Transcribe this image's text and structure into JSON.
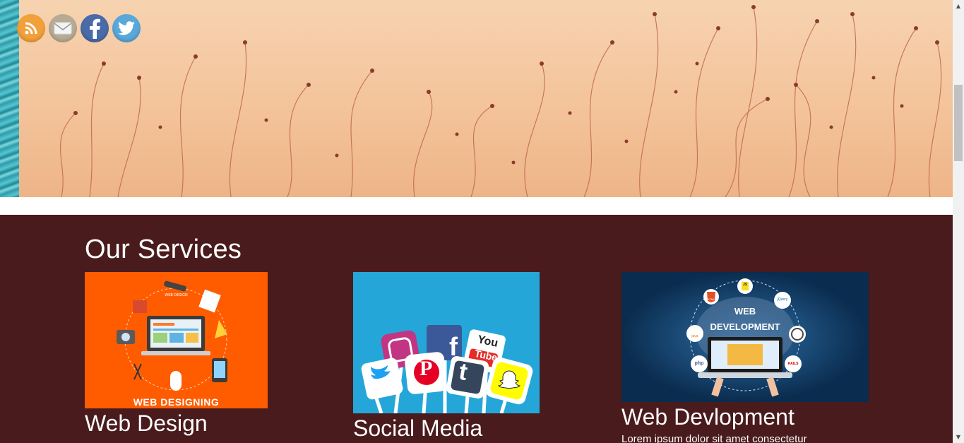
{
  "hero": {
    "social_icons": [
      {
        "name": "rss-icon",
        "color": "#f2a03a"
      },
      {
        "name": "email-icon",
        "color": "#b8ab95"
      },
      {
        "name": "facebook-icon",
        "color": "#4a6aa8"
      },
      {
        "name": "twitter-icon",
        "color": "#5aa7d9"
      }
    ]
  },
  "services": {
    "heading": "Our Services",
    "background": "#4a1b1d",
    "cards": [
      {
        "title": "Web Design",
        "image_caption": "WEB DESIGNING",
        "image_small_text": "WEB DESIGN",
        "image_bg": "#ff5c00"
      },
      {
        "title": "Social Media",
        "image_labels": [
          "f",
          "You",
          "Tube",
          "t",
          "P"
        ],
        "image_bg": "#24a7d8"
      },
      {
        "title": "Web Devlopment",
        "image_title_1": "WEB",
        "image_title_2": "DEVELOPMENT",
        "image_labels": [
          "jQuery",
          "php",
          "RAILS",
          "java",
          "HTML",
          "JS"
        ],
        "image_bg": "#0a2c4e",
        "desc": "Lorem ipsum dolor sit amet consectetur"
      }
    ]
  }
}
